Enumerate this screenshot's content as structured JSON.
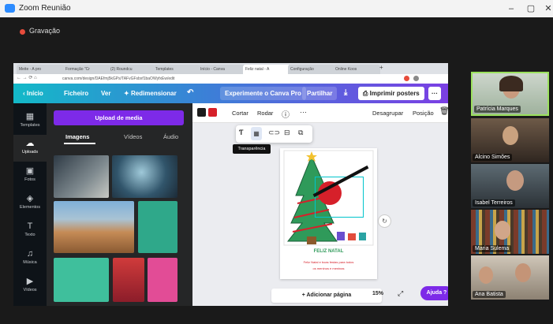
{
  "zoom": {
    "title": "Zoom Reunião",
    "recording_label": "Gravação",
    "controls": {
      "minimize": "–",
      "restore": "▢",
      "close": "✕"
    }
  },
  "browser": {
    "tabs": [
      "Meite - A pro",
      "Formação \"Cr",
      "(2) Roundcu",
      "Templates",
      "Início - Canva",
      "Feliz natal - A",
      "Configuração",
      "Online Koos"
    ],
    "new_tab": "+",
    "address": "canva.com/design/DAEfmj5kGPs/TAFvGFsbxf1baOWyfxEw/edit"
  },
  "canva_header": {
    "home": "Início",
    "file": "Ficheiro",
    "view": "Ver",
    "resize": "Redimensionar",
    "undo_icon": "↶",
    "try_pro": "Experimente o Canva Pro",
    "share": "Partilhar",
    "download_icon": "⤓",
    "print": "Imprimir posters",
    "more": "···"
  },
  "rail": [
    {
      "icon": "▦",
      "label": "Templates"
    },
    {
      "icon": "☁",
      "label": "Uploads"
    },
    {
      "icon": "▣",
      "label": "Fotos"
    },
    {
      "icon": "◈",
      "label": "Elementos"
    },
    {
      "icon": "T",
      "label": "Texto"
    },
    {
      "icon": "♫",
      "label": "Música"
    },
    {
      "icon": "▶",
      "label": "Vídeos"
    }
  ],
  "uploads_panel": {
    "upload_button": "Upload de media",
    "tabs": [
      "Imagens",
      "Vídeos",
      "Áudio"
    ],
    "collapse": "‹"
  },
  "toolbar": {
    "colors": [
      "#1c1c1c",
      "#d6202a"
    ],
    "crop": "Cortar",
    "flip": "Rodar",
    "info": "ⓘ",
    "more": "···",
    "ungroup": "Desagrupar",
    "position": "Posição",
    "trash_icon": "🗑"
  },
  "popover": {
    "tooltip": "Transparência"
  },
  "design": {
    "heading": "FELIZ NATAL",
    "line1": "Feliz Natal e boas festas para todos",
    "line2": "os meninos e meninas"
  },
  "bottom": {
    "add_page": "+ Adicionar página",
    "zoom": "15%",
    "fullscreen": "⤢",
    "help": "Ajuda ?"
  },
  "participants": [
    {
      "name": "Patrícia Marques"
    },
    {
      "name": "Alcino Simões"
    },
    {
      "name": "Isabel Terreiros"
    },
    {
      "name": "Maria Sulema"
    },
    {
      "name": "Ana Batista"
    }
  ]
}
